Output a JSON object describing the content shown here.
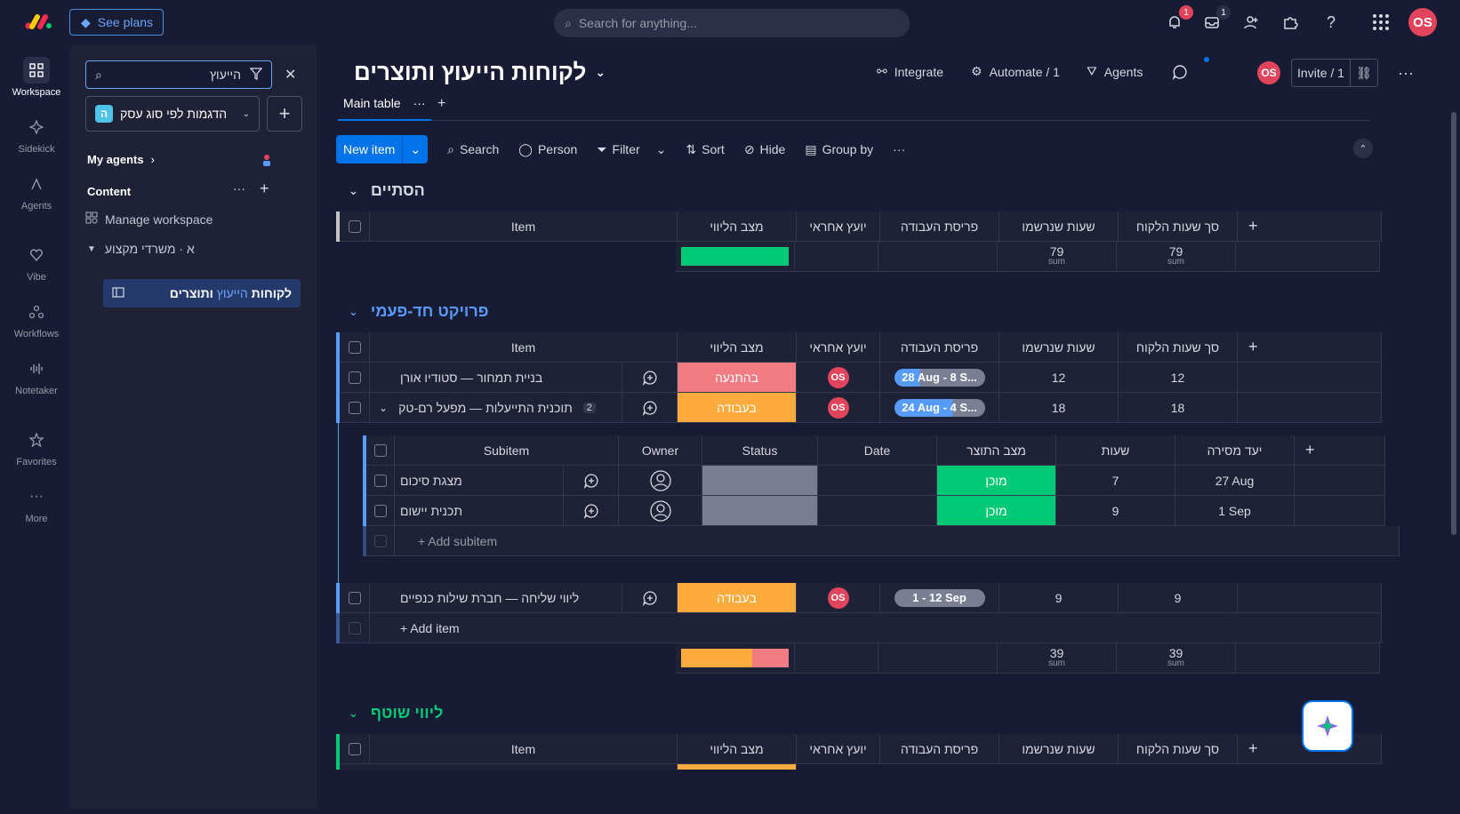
{
  "topbar": {
    "see_plans": "See plans",
    "search_placeholder": "Search for anything...",
    "notif_count": "1",
    "inbox_count": "1",
    "avatar": "OS"
  },
  "rail": [
    {
      "label": "Workspace",
      "icon": "grid-icon"
    },
    {
      "label": "Sidekick",
      "icon": "sparkle-icon"
    },
    {
      "label": "Agents",
      "icon": "agent-icon"
    },
    {
      "label": "Vibe",
      "icon": "heart-icon"
    },
    {
      "label": "Workflows",
      "icon": "workflow-icon"
    },
    {
      "label": "Notetaker",
      "icon": "waveform-icon"
    },
    {
      "label": "Favorites",
      "icon": "star-icon"
    },
    {
      "label": "More",
      "icon": "more-icon"
    }
  ],
  "panel": {
    "search_value": "הייעוץ",
    "workspace_badge": "ה",
    "workspace_name": "הדגמות לפי סוג עסק",
    "my_agents": "My agents",
    "content": "Content",
    "manage_workspace": "Manage workspace",
    "folder": "א · משרדי מקצוע",
    "board_prefix": "לקוחות",
    "board_highlight": "הייעוץ",
    "board_suffix": "ותוצרים"
  },
  "board": {
    "title": "לקוחות הייעוץ ותוצרים",
    "integrate": "Integrate",
    "automate": "Automate / 1",
    "agents": "Agents",
    "avatar": "OS",
    "invite": "Invite / 1",
    "tab_main": "Main table"
  },
  "toolbar": {
    "new_item": "New item",
    "search": "Search",
    "person": "Person",
    "filter": "Filter",
    "sort": "Sort",
    "hide": "Hide",
    "group_by": "Group by"
  },
  "columns": {
    "item": "Item",
    "status": "מצב הליווי",
    "owner": "יועץ אחראי",
    "timeline": "פריסת העבודה",
    "hours": "שעות שנרשמו",
    "client_hours": "סך שעות הלקוח"
  },
  "sub_columns": {
    "subitem": "Subitem",
    "owner": "Owner",
    "status": "Status",
    "date": "Date",
    "prod_status": "מצב התוצר",
    "hours": "שעות",
    "due": "יעד מסירה"
  },
  "groups": [
    {
      "title": "הסתיים",
      "color": "#c4c4c4",
      "sum_hours": "79",
      "sum_client": "79",
      "sum_label": "sum"
    },
    {
      "title": "פרויקט חד-פעמי",
      "color": "#579bfc",
      "sum_hours": "39",
      "sum_client": "39",
      "sum_label": "sum",
      "items": [
        {
          "name": "בניית תמחור — סטודיו אורן",
          "status": "בהתנעה",
          "status_color": "#f27b84",
          "owner": "OS",
          "timeline": "28 Aug - 8 S...",
          "hours": "12",
          "client": "12"
        },
        {
          "name": "תוכנית התייעלות — מפעל רם-טק",
          "status": "בעבודה",
          "status_color": "#fdab3d",
          "owner": "OS",
          "timeline": "24 Aug - 4 S...",
          "hours": "18",
          "client": "18",
          "sub_count": "2"
        },
        {
          "name": "ליווי שליחה — חברת שילות כנפיים",
          "status": "בעבודה",
          "status_color": "#fdab3d",
          "owner": "OS",
          "timeline": "1 - 12 Sep",
          "hours": "9",
          "client": "9"
        }
      ],
      "subitems": [
        {
          "name": "מצגת סיכום",
          "prod_status": "מוכן",
          "hours": "7",
          "due": "27 Aug"
        },
        {
          "name": "תכנית יישום",
          "prod_status": "מוכן",
          "hours": "9",
          "due": "1 Sep"
        }
      ],
      "add_subitem": "+ Add subitem",
      "add_item": "+ Add item"
    },
    {
      "title": "ליווי שוטף",
      "color": "#00c875"
    }
  ]
}
